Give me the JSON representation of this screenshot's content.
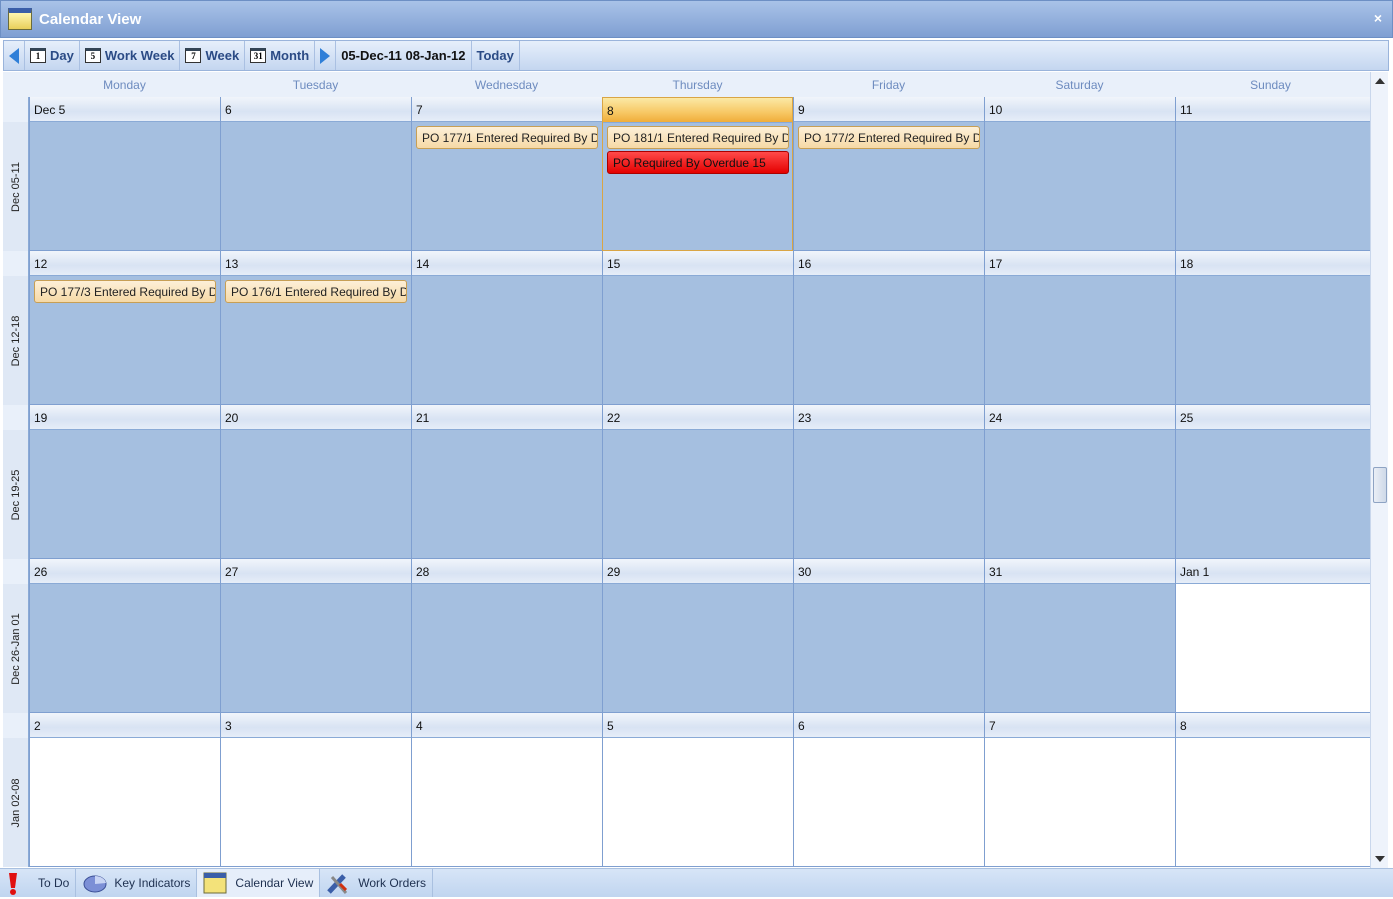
{
  "window": {
    "title": "Calendar View",
    "close": "×"
  },
  "toolbar": {
    "day": "Day",
    "day_icon": "1",
    "work_week": "Work Week",
    "work_week_icon": "5",
    "week": "Week",
    "week_icon": "7",
    "month": "Month",
    "month_icon": "31",
    "range": "05-Dec-11 08-Jan-12",
    "today": "Today"
  },
  "day_names": [
    "Monday",
    "Tuesday",
    "Wednesday",
    "Thursday",
    "Friday",
    "Saturday",
    "Sunday"
  ],
  "weeks": [
    {
      "label": "Dec 05-11",
      "days": [
        "Dec 5",
        "6",
        "7",
        "8",
        "9",
        "10",
        "11"
      ],
      "in": [
        1,
        1,
        1,
        1,
        1,
        1,
        1
      ]
    },
    {
      "label": "Dec 12-18",
      "days": [
        "12",
        "13",
        "14",
        "15",
        "16",
        "17",
        "18"
      ],
      "in": [
        1,
        1,
        1,
        1,
        1,
        1,
        1
      ]
    },
    {
      "label": "Dec 19-25",
      "days": [
        "19",
        "20",
        "21",
        "22",
        "23",
        "24",
        "25"
      ],
      "in": [
        1,
        1,
        1,
        1,
        1,
        1,
        1
      ]
    },
    {
      "label": "Dec 26-Jan 01",
      "days": [
        "26",
        "27",
        "28",
        "29",
        "30",
        "31",
        "Jan 1"
      ],
      "in": [
        1,
        1,
        1,
        1,
        1,
        1,
        0
      ]
    },
    {
      "label": "Jan 02-08",
      "days": [
        "2",
        "3",
        "4",
        "5",
        "6",
        "7",
        "8"
      ],
      "in": [
        0,
        0,
        0,
        0,
        0,
        0,
        0
      ]
    }
  ],
  "today": {
    "week": 0,
    "day": 3
  },
  "events": [
    {
      "week": 0,
      "day": 2,
      "slot": 0,
      "text": "PO 177/1 Entered Required By D...",
      "type": "normal"
    },
    {
      "week": 0,
      "day": 3,
      "slot": 0,
      "text": "PO 181/1 Entered Required By D...",
      "type": "normal"
    },
    {
      "week": 0,
      "day": 3,
      "slot": 1,
      "text": "PO Required By Overdue 15",
      "type": "overdue"
    },
    {
      "week": 0,
      "day": 4,
      "slot": 0,
      "text": "PO 177/2 Entered Required By D...",
      "type": "normal"
    },
    {
      "week": 1,
      "day": 0,
      "slot": 0,
      "text": "PO 177/3 Entered Required By D...",
      "type": "normal"
    },
    {
      "week": 1,
      "day": 1,
      "slot": 0,
      "text": "PO 176/1 Entered Required By D...",
      "type": "normal"
    }
  ],
  "bottom_tabs": [
    {
      "label": "To Do",
      "icon": "exclamation-icon"
    },
    {
      "label": "Key Indicators",
      "icon": "pie-chart-icon"
    },
    {
      "label": "Calendar View",
      "icon": "calendar-icon",
      "active": true
    },
    {
      "label": "Work Orders",
      "icon": "tools-icon"
    }
  ],
  "colors": {
    "in_range": "#a5bfe0",
    "today_header": "#f7c865",
    "event": "#f6d9a6",
    "overdue": "#e40000"
  }
}
